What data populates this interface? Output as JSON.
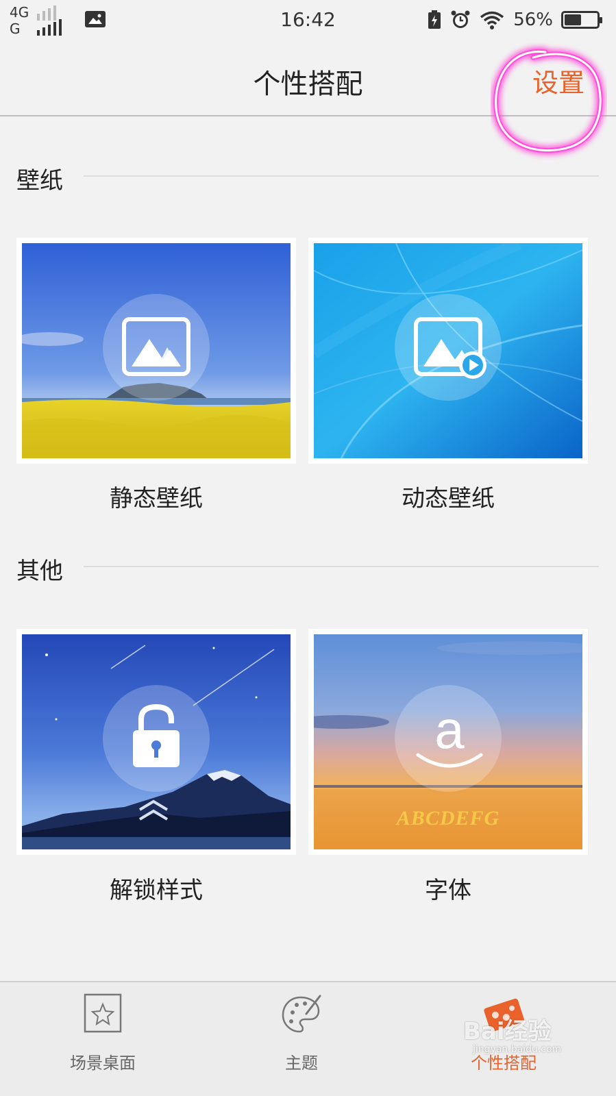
{
  "status_bar": {
    "network_top": "4G",
    "network_bottom": "G",
    "time": "16:42",
    "battery_percent": "56%",
    "battery_level": 0.56
  },
  "header": {
    "title": "个性搭配",
    "settings_label": "设置",
    "annotation_color": "#ff4fd8",
    "accent_color": "#e9622c"
  },
  "sections": {
    "wallpaper": {
      "label": "壁纸",
      "items": [
        {
          "label": "静态壁纸",
          "icon": "image-icon"
        },
        {
          "label": "动态壁纸",
          "icon": "video-image-icon"
        }
      ]
    },
    "other": {
      "label": "其他",
      "items": [
        {
          "label": "解锁样式",
          "icon": "lock-icon"
        },
        {
          "label": "字体",
          "icon": "font-icon",
          "sample_text": "ABCDEFG"
        }
      ]
    }
  },
  "bottom_nav": {
    "items": [
      {
        "label": "场景桌面",
        "icon": "star-frame-icon"
      },
      {
        "label": "主题",
        "icon": "palette-icon"
      },
      {
        "label": "个性搭配",
        "icon": "personalize-icon",
        "active": true
      }
    ]
  },
  "watermark": {
    "text": "Bai经验",
    "sub": "jingyan.baidu.com"
  }
}
